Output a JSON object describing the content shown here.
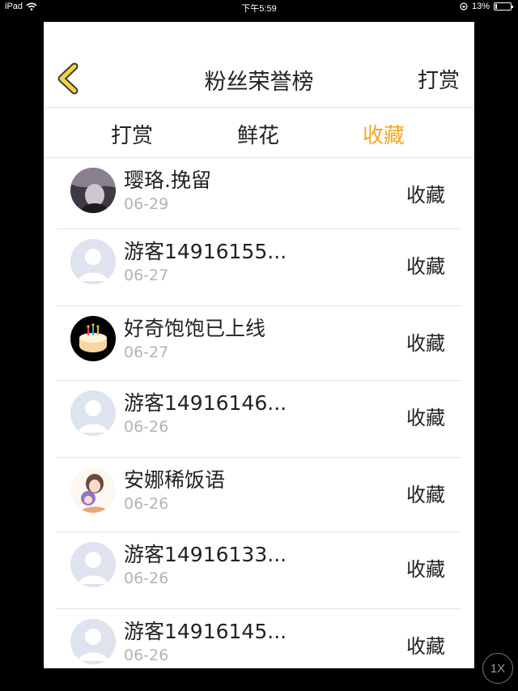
{
  "status_bar": {
    "device": "iPad",
    "time": "下午5:59",
    "battery": "13%",
    "battery_level": 0.13
  },
  "header": {
    "title": "粉丝荣誉榜",
    "right_action": "打赏",
    "back_icon": "chevron-left-icon",
    "accent_color": "#f5a623"
  },
  "tabs": [
    {
      "label": "打赏",
      "active": false
    },
    {
      "label": "鲜花",
      "active": false
    },
    {
      "label": "收藏",
      "active": true
    }
  ],
  "list": [
    {
      "name": "璎珞.挽留",
      "date": "06-29",
      "action": "收藏",
      "avatar": "photo"
    },
    {
      "name": "游客14916155...",
      "date": "06-27",
      "action": "收藏",
      "avatar": "default"
    },
    {
      "name": "好奇饱饱已上线",
      "date": "06-27",
      "action": "收藏",
      "avatar": "cake"
    },
    {
      "name": "游客14916146...",
      "date": "06-26",
      "action": "收藏",
      "avatar": "default"
    },
    {
      "name": "安娜稀饭语",
      "date": "06-26",
      "action": "收藏",
      "avatar": "anime"
    },
    {
      "name": "游客14916133...",
      "date": "06-26",
      "action": "收藏",
      "avatar": "default"
    },
    {
      "name": "游客14916145...",
      "date": "06-26",
      "action": "收藏",
      "avatar": "default"
    }
  ],
  "zoom_button": "1X"
}
